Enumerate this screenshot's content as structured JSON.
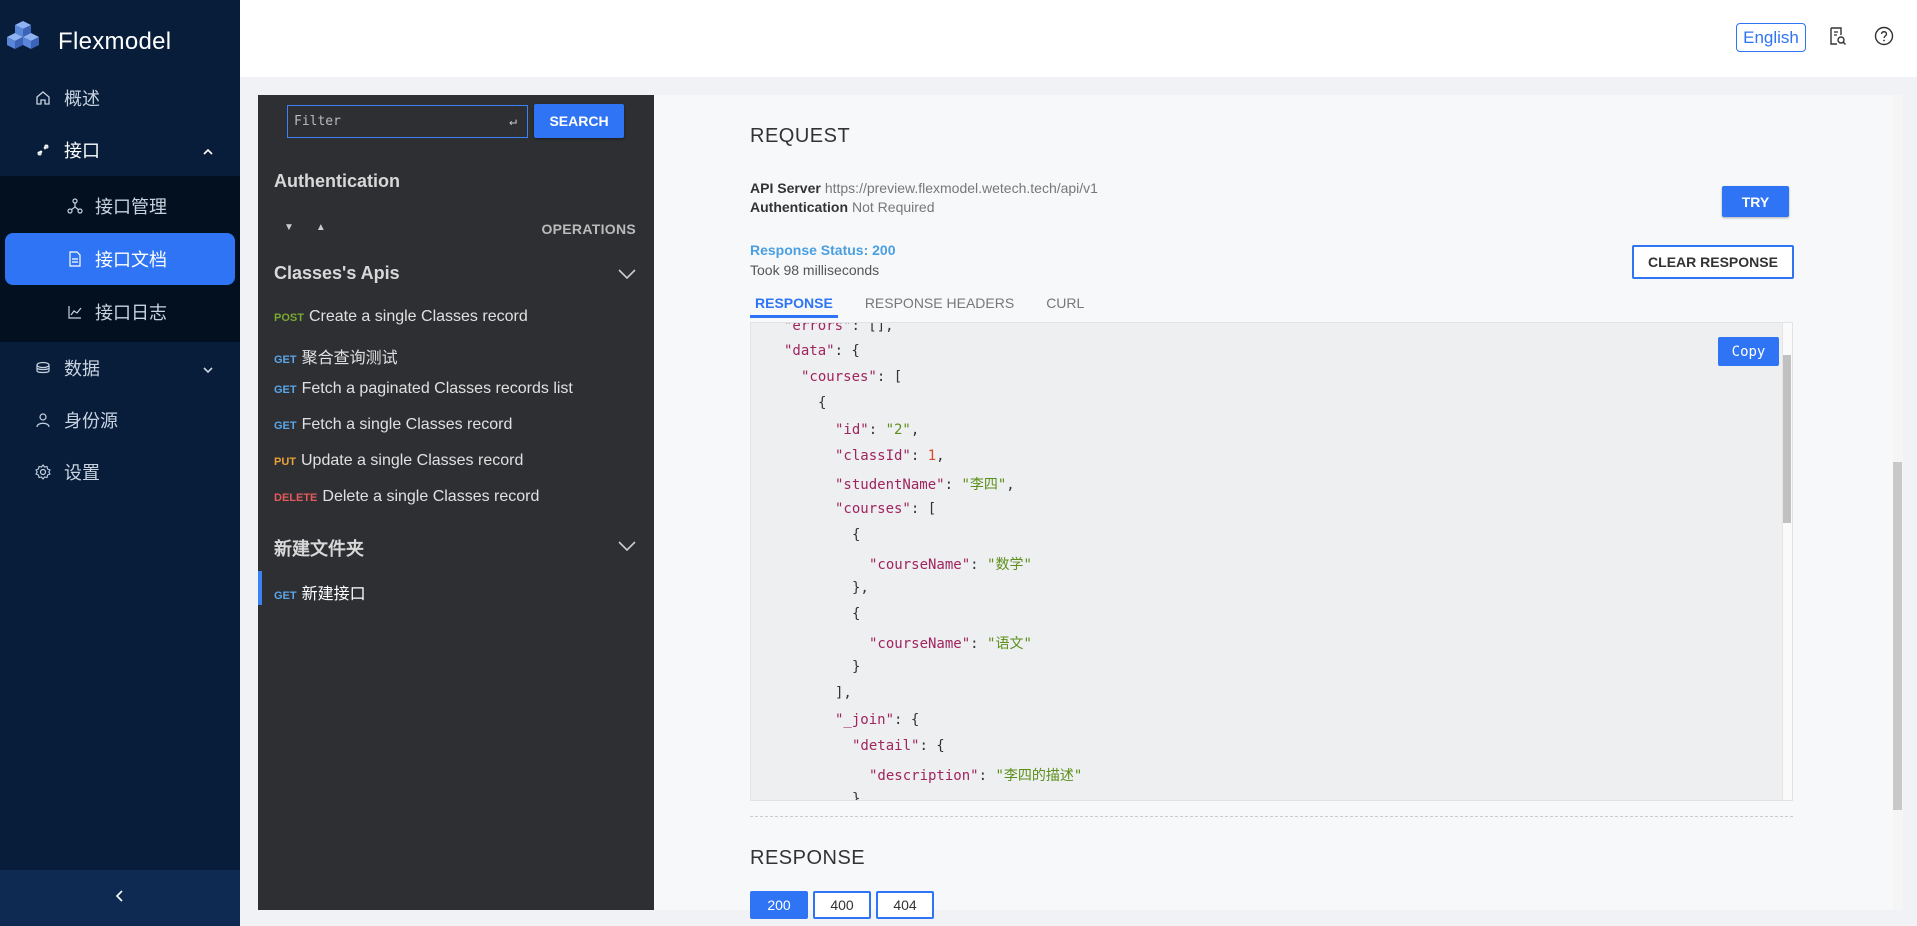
{
  "app": {
    "name": "Flexmodel"
  },
  "sidebar": {
    "items": [
      {
        "label": "概述",
        "icon": "home-icon"
      },
      {
        "label": "接口",
        "icon": "api-icon",
        "expanded": true,
        "children": [
          {
            "label": "接口管理",
            "icon": "network-icon"
          },
          {
            "label": "接口文档",
            "icon": "document-icon",
            "active": true
          },
          {
            "label": "接口日志",
            "icon": "line-chart-icon"
          }
        ]
      },
      {
        "label": "数据",
        "icon": "database-icon"
      },
      {
        "label": "身份源",
        "icon": "user-icon"
      },
      {
        "label": "设置",
        "icon": "gear-icon"
      }
    ],
    "collapse_icon": "chevron-left-icon"
  },
  "header": {
    "language": "English",
    "icons": [
      "doc-search-icon",
      "help-icon"
    ]
  },
  "api_list": {
    "filter_placeholder": "Filter",
    "search_label": "SEARCH",
    "auth_section": "Authentication",
    "operations_label": "OPERATIONS",
    "groups": [
      {
        "title": "Classes's Apis",
        "ops": [
          {
            "method": "POST",
            "label": "Create a single Classes record"
          },
          {
            "method": "GET",
            "label": "聚合查询测试"
          },
          {
            "method": "GET",
            "label": "Fetch a paginated Classes records list"
          },
          {
            "method": "GET",
            "label": "Fetch a single Classes record"
          },
          {
            "method": "PUT",
            "label": "Update a single Classes record"
          },
          {
            "method": "DELETE",
            "label": "Delete a single Classes record"
          }
        ]
      },
      {
        "title": "新建文件夹",
        "ops": [
          {
            "method": "GET",
            "label": "新建接口",
            "active": true
          }
        ]
      }
    ]
  },
  "request": {
    "title": "REQUEST",
    "api_server_label": "API Server",
    "api_server_value": "https://preview.flexmodel.wetech.tech/api/v1",
    "auth_label": "Authentication",
    "auth_value": "Not Required",
    "try_label": "TRY",
    "status_text": "Response Status: 200",
    "took_text": "Took 98 milliseconds",
    "clear_label": "CLEAR RESPONSE",
    "tabs": [
      "RESPONSE",
      "RESPONSE HEADERS",
      "CURL"
    ],
    "copy_label": "Copy",
    "code_lines": [
      "\"errors\": [],",
      "\"data\": {",
      "\"courses\": [",
      "{",
      "\"id\": \"2\",",
      "\"classId\": 1,",
      "\"studentName\": \"李四\",",
      "\"courses\": [",
      "{",
      "\"courseName\": \"数学\"",
      "},",
      "{",
      "\"courseName\": \"语文\"",
      "}",
      "],",
      "\"_join\": {",
      "\"detail\": {",
      "\"description\": \"李四的描述\"",
      "}"
    ]
  },
  "response": {
    "title": "RESPONSE",
    "codes": [
      "200",
      "400",
      "404"
    ]
  },
  "colors": {
    "sidebar_bg": "#071d3a",
    "accent": "#2f74f5",
    "dark_panel_bg": "#2d2f33"
  }
}
